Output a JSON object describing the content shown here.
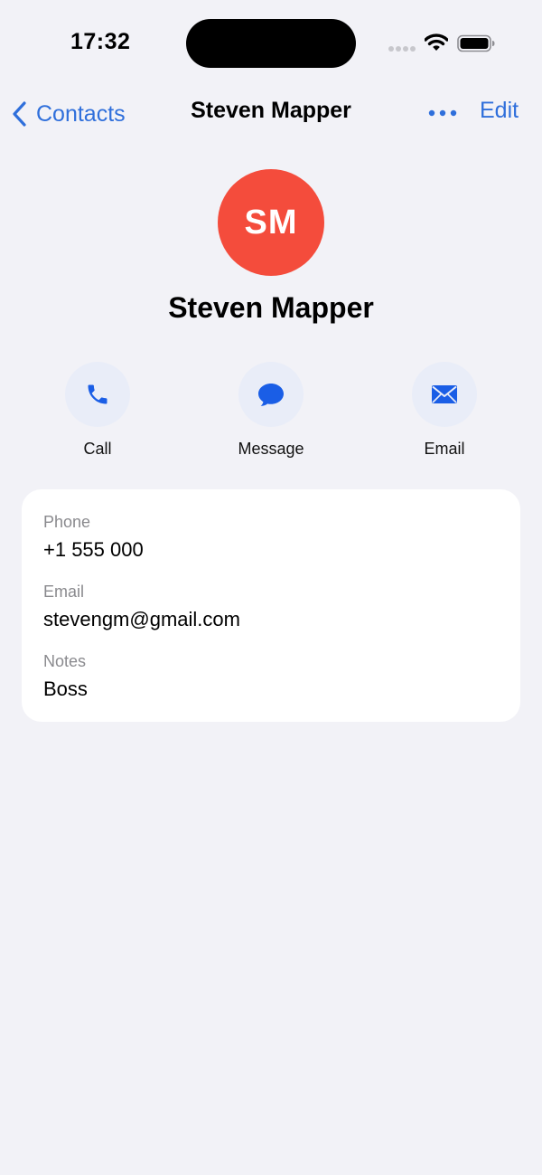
{
  "status_bar": {
    "time": "17:32"
  },
  "nav": {
    "back_label": "Contacts",
    "title": "Steven Mapper",
    "edit_label": "Edit"
  },
  "contact": {
    "initials": "SM",
    "name": "Steven Mapper",
    "avatar_color": "#f44c3c"
  },
  "actions": [
    {
      "label": "Call",
      "icon": "phone-icon"
    },
    {
      "label": "Message",
      "icon": "message-icon"
    },
    {
      "label": "Email",
      "icon": "mail-icon"
    }
  ],
  "fields": {
    "phone": {
      "label": "Phone",
      "value": "+1 555 000"
    },
    "email": {
      "label": "Email",
      "value": "stevengm@gmail.com"
    },
    "notes": {
      "label": "Notes",
      "value": "Boss"
    }
  },
  "colors": {
    "accent": "#2f6fdb",
    "background": "#f2f2f7",
    "action_circle": "#e9edf8"
  }
}
